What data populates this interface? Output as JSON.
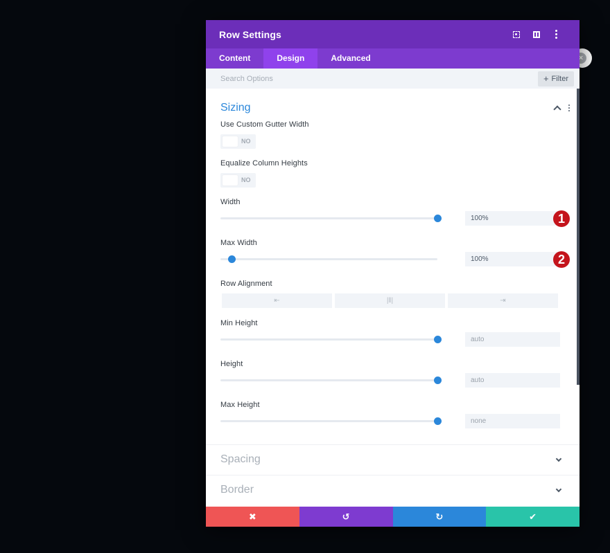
{
  "modal": {
    "title": "Row Settings",
    "header_icons": [
      "focus-mode-icon",
      "split-view-icon",
      "more-options-icon"
    ]
  },
  "tabs": [
    {
      "label": "Content",
      "active": false
    },
    {
      "label": "Design",
      "active": true
    },
    {
      "label": "Advanced",
      "active": false
    }
  ],
  "search": {
    "placeholder": "Search Options",
    "value": "",
    "filter_label": "Filter"
  },
  "section": {
    "title": "Sizing",
    "expanded": true,
    "fields": {
      "gutter": {
        "label": "Use Custom Gutter Width",
        "toggle": "NO"
      },
      "equalize": {
        "label": "Equalize Column Heights",
        "toggle": "NO"
      },
      "width": {
        "label": "Width",
        "value": "100%",
        "slider_percent": 100,
        "badge": "1"
      },
      "max_width": {
        "label": "Max Width",
        "value": "100%",
        "slider_percent": 5,
        "badge": "2"
      },
      "row_alignment": {
        "label": "Row Alignment",
        "options": [
          "left",
          "center",
          "right"
        ],
        "glyphs": [
          "⇤",
          "|‖|",
          "⇥"
        ]
      },
      "min_height": {
        "label": "Min Height",
        "value": "auto",
        "slider_percent": 100
      },
      "height": {
        "label": "Height",
        "value": "auto",
        "slider_percent": 100
      },
      "max_height": {
        "label": "Max Height",
        "value": "none",
        "slider_percent": 100
      }
    }
  },
  "collapsed_sections": [
    {
      "title": "Spacing"
    },
    {
      "title": "Border"
    }
  ],
  "actions": {
    "cancel": "✖",
    "undo": "↺",
    "redo": "↻",
    "save": "✔"
  },
  "colors": {
    "header": "#6c2eb9",
    "tabs": "#7d3bcf",
    "active_tab": "#8f42ec",
    "accent": "#2b87da",
    "cancel": "#ef5555",
    "undo": "#7e3bd0",
    "redo": "#2b87da",
    "save": "#29c4a9",
    "badge": "#c4141c"
  }
}
